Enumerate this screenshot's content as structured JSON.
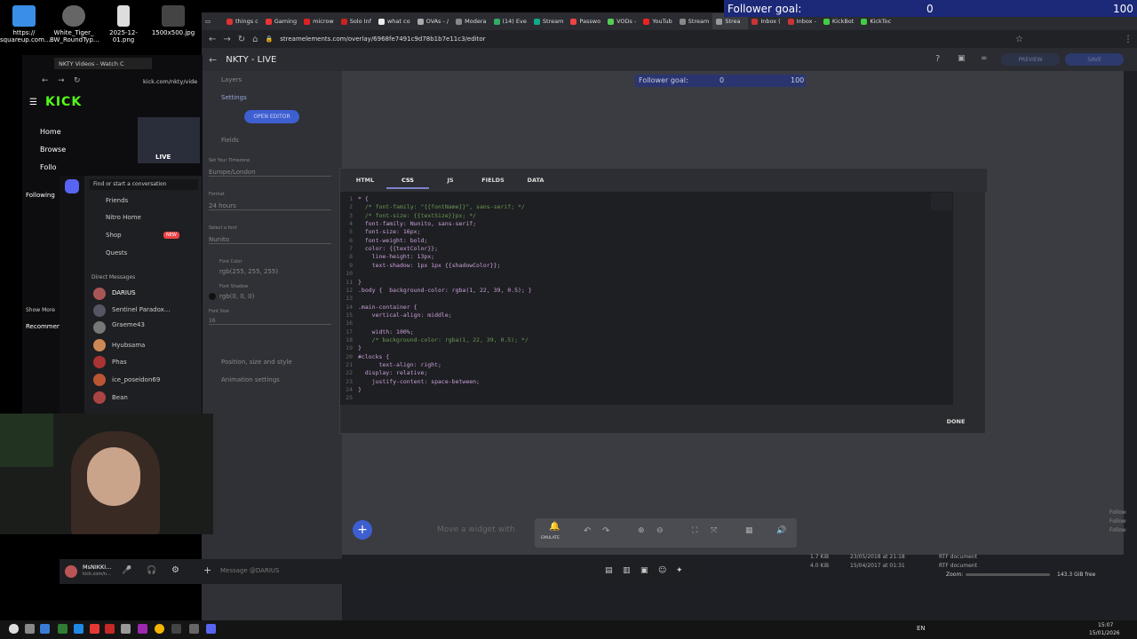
{
  "desktop": {
    "icons": [
      {
        "label": "https://\nsquareup.com..."
      },
      {
        "label": "White_Tiger_\nBW_RoundTyp..."
      },
      {
        "label": "2025-12-01.png"
      },
      {
        "label": "1500x500.jpg"
      }
    ]
  },
  "follower_overlay": {
    "label": "Follower goal:",
    "current": "0",
    "goal": "100"
  },
  "main_browser": {
    "tabs": [
      "things c",
      "Gaming",
      "microw",
      "Solo Inf",
      "what co",
      "OVAs - /",
      "Modera",
      "(14) Eve",
      "Stream",
      "Passwo",
      "VODs -",
      "YouTub",
      "Stream",
      "Strea",
      "Inbox (",
      "Inbox -",
      "KickBot",
      "KickToc"
    ],
    "url": "streamelements.com/overlay/6968fe7491c9d78b1b7e11c3/editor",
    "page_title": "NKTY - LIVE",
    "preview_label": "PREVIEW",
    "save_label": "SAVE",
    "left_panel": {
      "layers": "Layers",
      "settings": "Settings",
      "open_editor": "OPEN EDITOR",
      "fields": "Fields",
      "timezone_label": "Set Your Timezone",
      "timezone_value": "Europe/London",
      "format_label": "Format",
      "format_value": "24 hours",
      "font_label": "Select a font",
      "font_value": "Nunito",
      "font_color_label": "Font Color",
      "font_color_value": "rgb(255, 255, 255)",
      "shadow_label": "Font Shadow",
      "shadow_value": "rgb(0, 0, 0)",
      "size_label": "Font Size",
      "size_value": "16",
      "position": "Position, size and style",
      "animation": "Animation settings"
    },
    "canvas_goal": {
      "label": "Follower goal:",
      "current": "0",
      "goal": "100"
    },
    "modal": {
      "tabs": [
        "HTML",
        "CSS",
        "JS",
        "FIELDS",
        "DATA"
      ],
      "active_tab": "CSS",
      "done": "DONE",
      "code_lines": [
        "* {",
        "  /* font-family: \"{{fontName}}\", sans-serif; */",
        "  /* font-size: {{textSize}}px; */",
        "  font-family: Nunito, sans-serif;",
        "  font-size: 16px;",
        "  font-weight: bold;",
        "  color: {{textColor}};",
        "    line-height: 13px;",
        "    text-shadow: 1px 1px {{shadowColor}};",
        "",
        "}",
        ".body {  background-color: rgba(1, 22, 39, 0.5); }",
        "",
        ".main-container {",
        "    vertical-align: middle;",
        "",
        "    width: 100%;",
        "    /* background-color: rgba(1, 22, 39, 0.5); */",
        "}",
        "#clocks {",
        "      text-align: right;",
        "  display: relative;",
        "    justify-content: space-between;",
        "}",
        ""
      ]
    },
    "bottom_text": "Move a widget with",
    "emulate": "EMULATE",
    "right_list": [
      "Follow",
      "Follow",
      "Follow"
    ]
  },
  "small_browser": {
    "tab": "NKTY Videos - Watch C",
    "url": "kick.com/nkty/vide",
    "logo": "KICK",
    "nav": [
      "Home",
      "Browse",
      "Follo"
    ],
    "following": "Following",
    "show_more": "Show More",
    "recommended": "Recommen",
    "live": "LIVE"
  },
  "discord": {
    "search": "Find or start a conversation",
    "items": [
      "Friends",
      "Nitro Home",
      "Shop",
      "Quests"
    ],
    "new_badge": "NEW",
    "dm_header": "Direct Messages",
    "dms": [
      "DARIUS",
      "Sentinel Paradox...",
      "Graeme43",
      "Hyubsama",
      "Phas",
      "ice_poseidon69",
      "Bean"
    ],
    "user": "MsNIKKI...",
    "user_sub": "kick.com/n...",
    "message_placeholder": "Message @DARIUS"
  },
  "file_info": {
    "rows": [
      {
        "size": "1.7 KiB",
        "date": "23/05/2018 at 21:18",
        "type": "RTF document"
      },
      {
        "size": "4.0 KiB",
        "date": "15/04/2017 at 01:31",
        "type": "RTF document"
      }
    ],
    "zoom_label": "Zoom:",
    "free": "143.3 GiB free"
  },
  "taskbar": {
    "lang": "EN",
    "time": "15:07",
    "date": "15/01/2026"
  }
}
